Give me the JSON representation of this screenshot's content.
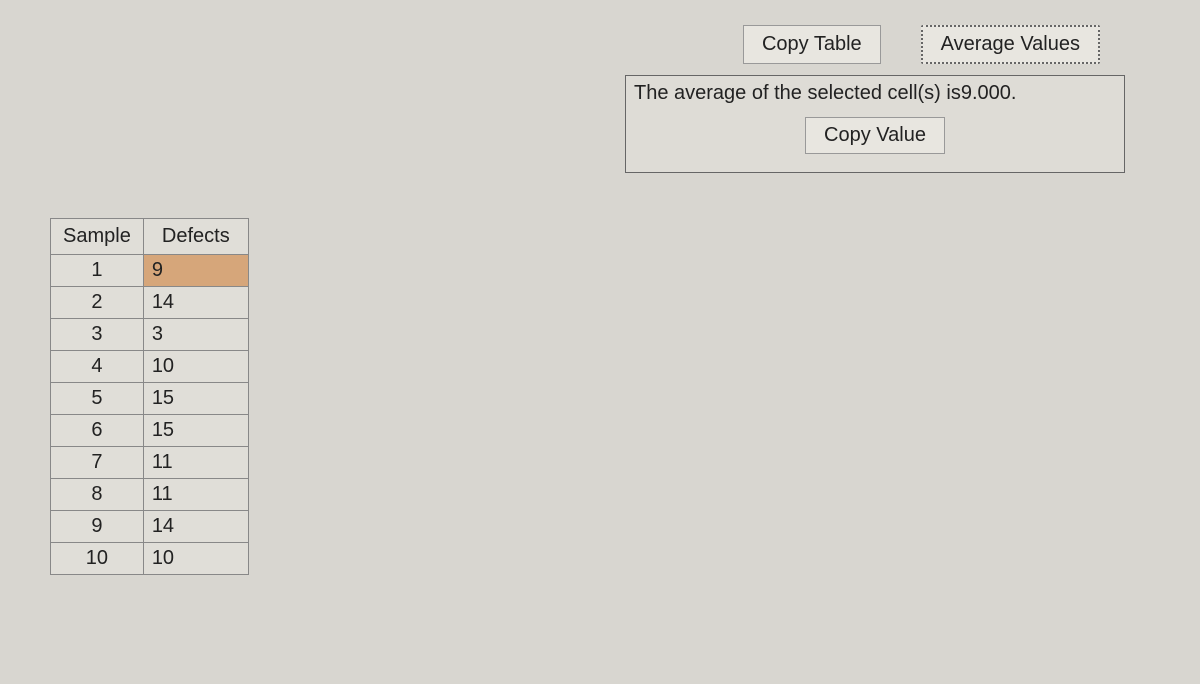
{
  "toolbar": {
    "copy_table_label": "Copy Table",
    "average_values_label": "Average Values"
  },
  "result": {
    "prefix": "The average of the selected cell(s) is",
    "value": "9.000",
    "suffix": ".",
    "copy_value_label": "Copy Value"
  },
  "table": {
    "headers": {
      "sample": "Sample",
      "defects": "Defects"
    },
    "rows": [
      {
        "sample": "1",
        "defects": "9",
        "selected": true
      },
      {
        "sample": "2",
        "defects": "14",
        "selected": false
      },
      {
        "sample": "3",
        "defects": "3",
        "selected": false
      },
      {
        "sample": "4",
        "defects": "10",
        "selected": false
      },
      {
        "sample": "5",
        "defects": "15",
        "selected": false
      },
      {
        "sample": "6",
        "defects": "15",
        "selected": false
      },
      {
        "sample": "7",
        "defects": "11",
        "selected": false
      },
      {
        "sample": "8",
        "defects": "11",
        "selected": false
      },
      {
        "sample": "9",
        "defects": "14",
        "selected": false
      },
      {
        "sample": "10",
        "defects": "10",
        "selected": false
      }
    ]
  }
}
